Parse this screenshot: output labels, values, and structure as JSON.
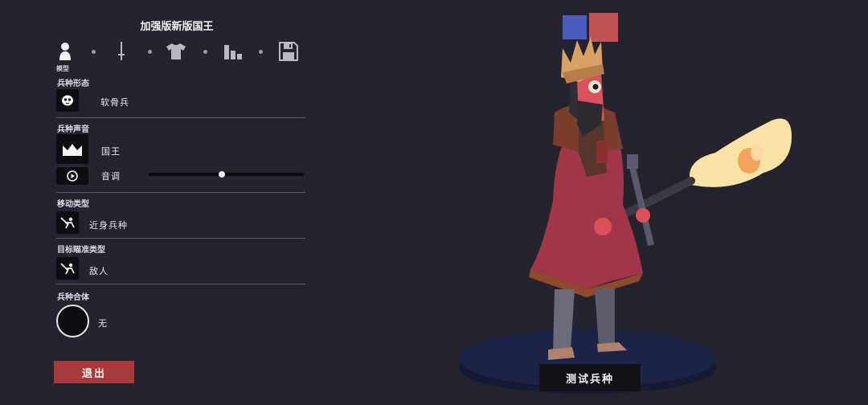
{
  "header": {
    "title": "加强版新版国王"
  },
  "tabs": {
    "items": [
      {
        "name": "model",
        "icon": "person-icon"
      },
      {
        "name": "weapon",
        "icon": "sword-icon"
      },
      {
        "name": "clothing",
        "icon": "shirt-icon"
      },
      {
        "name": "stats",
        "icon": "bars-icon"
      },
      {
        "name": "save",
        "icon": "floppy-disk-icon"
      }
    ],
    "active_caption": "模型"
  },
  "sections": {
    "form": {
      "label": "兵种形态",
      "value": "软骨兵",
      "icon": "mask-face-icon"
    },
    "voice": {
      "label": "兵种声音",
      "value": "国王",
      "icon": "crown-icon",
      "pitch_label": "音调",
      "pitch_icon": "play-icon",
      "pitch_level": 0.47
    },
    "movement": {
      "label": "移动类型",
      "value": "近身兵种",
      "icon": "melee-unit-icon"
    },
    "targeting": {
      "label": "目标瞄准类型",
      "value": "敌人",
      "icon": "melee-unit-icon"
    },
    "merge": {
      "label": "兵种合体",
      "value": "无"
    }
  },
  "actions": {
    "exit_label": "退出",
    "test_label": "测试兵种"
  },
  "team_colors": {
    "blue": "#4a5bbd",
    "red": "#c05355",
    "selected": "red"
  },
  "colors": {
    "background": "#24232e",
    "exit_button": "#a83a3a",
    "pedestal": "#1c2347"
  }
}
